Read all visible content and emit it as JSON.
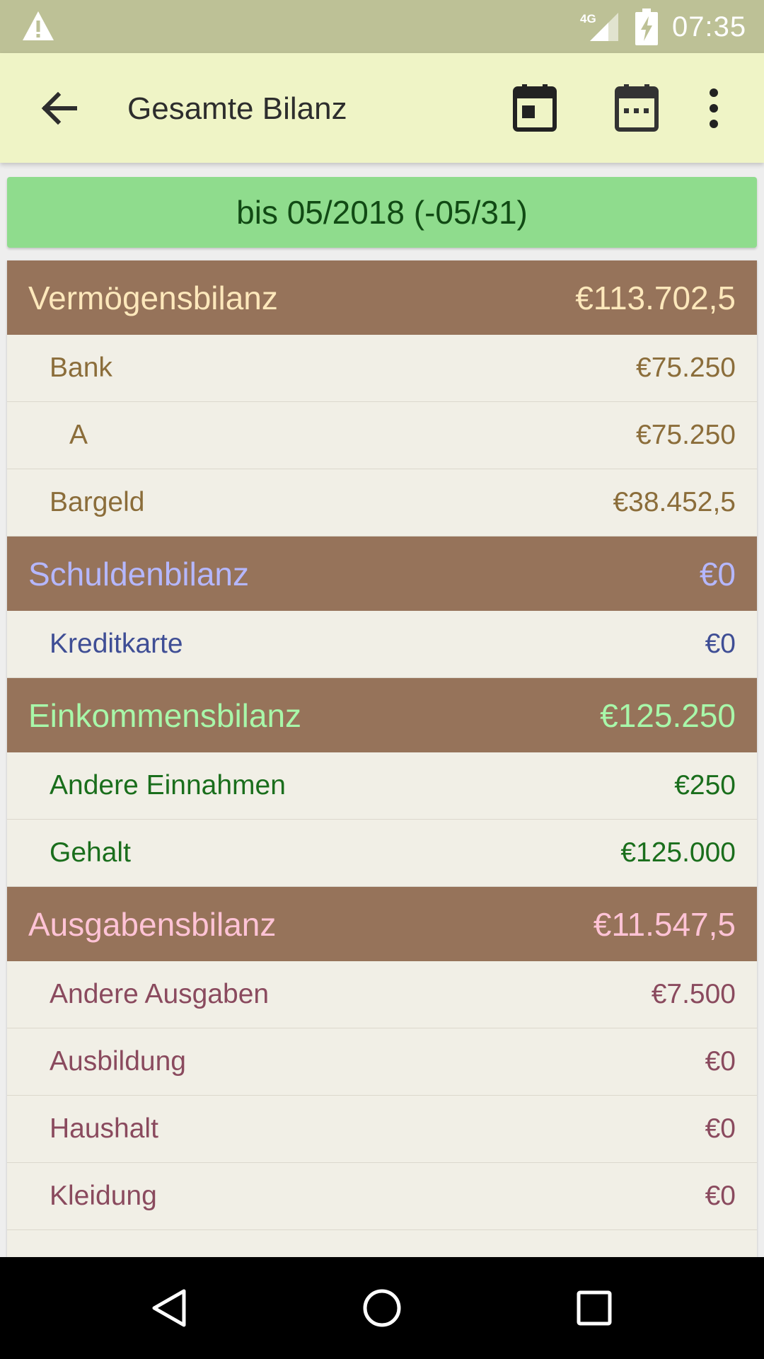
{
  "status_bar": {
    "network": "4G",
    "time": "07:35",
    "icons": [
      "warning-icon",
      "signal-icon",
      "battery-charging-icon"
    ]
  },
  "app_bar": {
    "title": "Gesamte Bilanz",
    "icons": [
      "back-arrow-icon",
      "calendar-today-icon",
      "calendar-month-icon",
      "more-vert-icon"
    ]
  },
  "period": {
    "label": "bis 05/2018 (-05/31)"
  },
  "sections": [
    {
      "title": "Vermögensbilanz",
      "total": "€113.702,5",
      "rows": [
        {
          "label": "Bank",
          "value": "€75.250"
        },
        {
          "label": "A",
          "value": "€75.250"
        },
        {
          "label": "Bargeld",
          "value": "€38.452,5"
        }
      ]
    },
    {
      "title": "Schuldenbilanz",
      "total": "€0",
      "rows": [
        {
          "label": "Kreditkarte",
          "value": "€0"
        }
      ]
    },
    {
      "title": "Einkommensbilanz",
      "total": "€125.250",
      "rows": [
        {
          "label": "Andere Einnahmen",
          "value": "€250"
        },
        {
          "label": "Gehalt",
          "value": "€125.000"
        }
      ]
    },
    {
      "title": "Ausgabensbilanz",
      "total": "€11.547,5",
      "rows": [
        {
          "label": "Andere Ausgaben",
          "value": "€7.500"
        },
        {
          "label": "Ausbildung",
          "value": "€0"
        },
        {
          "label": "Haushalt",
          "value": "€0"
        },
        {
          "label": "Kleidung",
          "value": "€0"
        }
      ]
    }
  ],
  "colors": {
    "status_bar": "#bdc196",
    "app_bar": "#eff4c6",
    "period_banner": "#8fdc8d",
    "section_header": "#96735a",
    "row_background": "#f1efe6"
  },
  "nav_bar": {
    "icons": [
      "nav-back-icon",
      "nav-home-icon",
      "nav-recents-icon"
    ]
  }
}
